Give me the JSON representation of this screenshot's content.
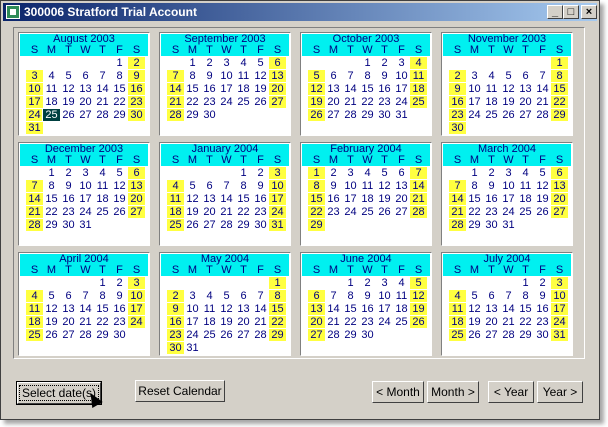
{
  "window": {
    "title": "300006 Stratford Trial Account"
  },
  "days_of_week": [
    "S",
    "M",
    "T",
    "W",
    "T",
    "F",
    "S"
  ],
  "months": [
    {
      "label": "August 2003",
      "start": 5,
      "days": 31,
      "selected": 25
    },
    {
      "label": "September 2003",
      "start": 1,
      "days": 30
    },
    {
      "label": "October 2003",
      "start": 3,
      "days": 31
    },
    {
      "label": "November 2003",
      "start": 6,
      "days": 30
    },
    {
      "label": "December 2003",
      "start": 1,
      "days": 31
    },
    {
      "label": "January 2004",
      "start": 4,
      "days": 31
    },
    {
      "label": "February 2004",
      "start": 0,
      "days": 29
    },
    {
      "label": "March 2004",
      "start": 1,
      "days": 31
    },
    {
      "label": "April 2004",
      "start": 4,
      "days": 30
    },
    {
      "label": "May 2004",
      "start": 6,
      "days": 31
    },
    {
      "label": "June 2004",
      "start": 2,
      "days": 30
    },
    {
      "label": "July 2004",
      "start": 4,
      "days": 31
    }
  ],
  "buttons": {
    "select": "Select date(s)",
    "reset": "Reset Calendar",
    "prev_month": "< Month",
    "next_month": "Month >",
    "prev_year": "< Year",
    "next_year": "Year >"
  },
  "colors": {
    "header": "#00f0f0",
    "weekend": "#ffff40",
    "text": "#000080",
    "selected": "#004040"
  }
}
